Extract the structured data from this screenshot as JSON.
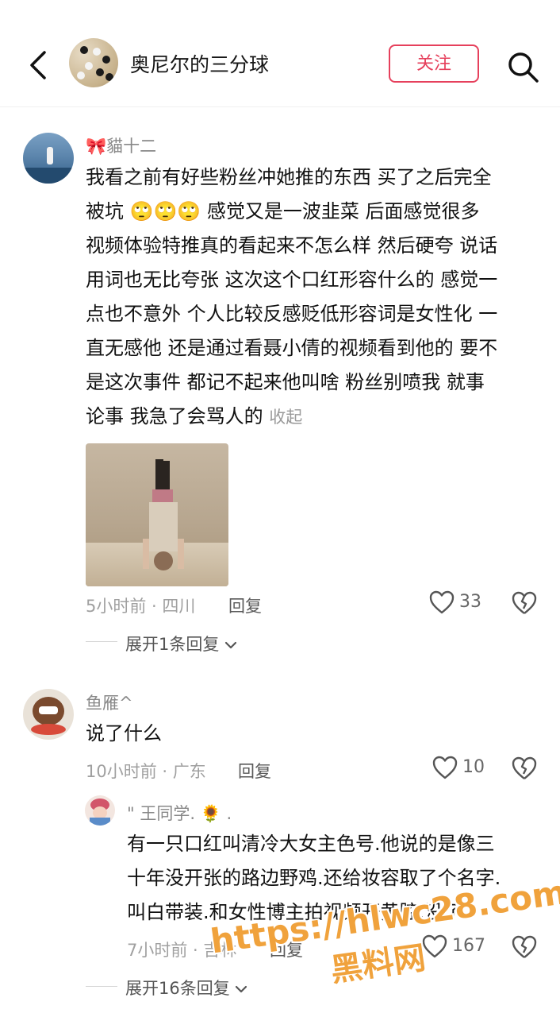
{
  "header": {
    "title": "奥尼尔的三分球",
    "follow_label": "关注",
    "back_icon": "chevron-left-icon",
    "search_icon": "search-icon"
  },
  "comments": [
    {
      "author": "🎀貓十二",
      "lines": [
        "我看之前有好些粉丝冲她推的东西 买了之后完全",
        "被坑 🙄🙄🙄 感觉又是一波韭菜 后面感觉很多",
        "视频体验特推真的看起来不怎么样 然后硬夸 说话",
        "用词也无比夸张 这次这个口红形容什么的 感觉一",
        "点也不意外 个人比较反感贬低形容词是女性化 一",
        "直无感他 还是通过看聂小倩的视频看到他的 要不",
        "是这次事件 都记不起来他叫啥 粉丝别喷我 就事",
        "论事 我急了会骂人的"
      ],
      "collapse_label": "收起",
      "meta": "5小时前 · 四川",
      "reply_label": "回复",
      "likes": "33",
      "expand_label": "展开1条回复"
    },
    {
      "author": "鱼雁^",
      "text": "说了什么",
      "meta": "10小时前 · 广东",
      "reply_label": "回复",
      "likes": "10",
      "expand_label": "展开16条回复"
    }
  ],
  "reply": {
    "author": "\" 王同学. 🌻 .",
    "lines": [
      "有一只口红叫清冷大女主色号.他说的是像三",
      "十年没开张的路边野鸡.还给妆容取了个名字.",
      "叫白带装.和女性博主拍视频开黄腔.没了"
    ],
    "meta": "7小时前 · 吉林",
    "reply_label": "回复",
    "likes": "167"
  },
  "watermark": {
    "line1": "https://hlwc28.com",
    "line2": "黑料网"
  },
  "colors": {
    "accent": "#e6405c",
    "watermark": "#f0a23c"
  }
}
